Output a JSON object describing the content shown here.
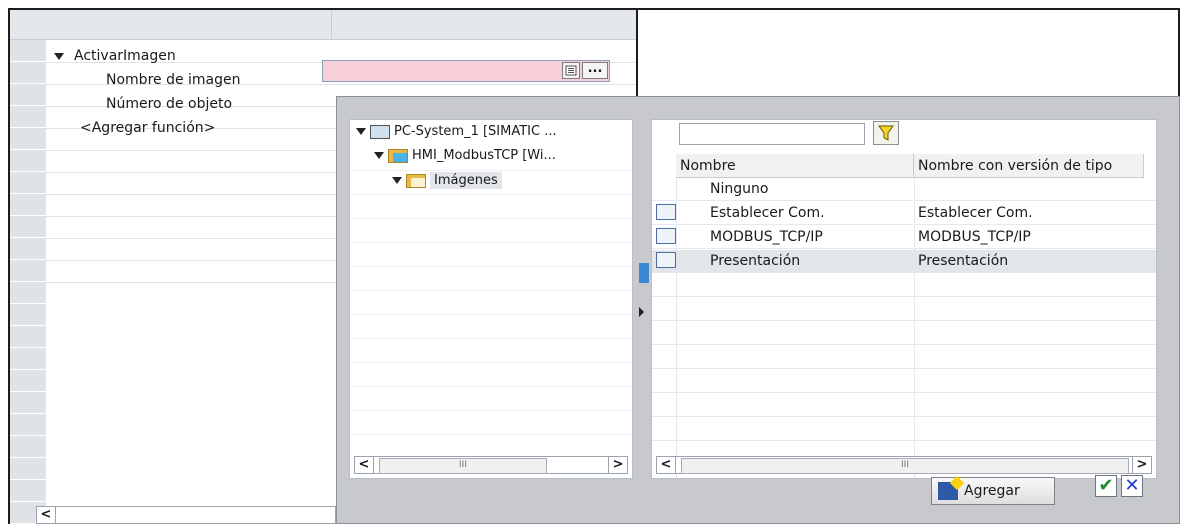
{
  "property_grid": {
    "rows": [
      {
        "label": "ActivarImagen",
        "expanded": true
      },
      {
        "label": "Nombre de imagen"
      },
      {
        "label": "Número de objeto"
      },
      {
        "label": "<Agregar función>"
      }
    ],
    "list_button_icon": "list-icon",
    "more_button_label": "..."
  },
  "popup": {
    "tree": [
      {
        "label": "PC-System_1 [SIMATIC ...",
        "icon": "pc-station-icon"
      },
      {
        "label": "HMI_ModbusTCP [Wi...",
        "icon": "hmi-folder-icon"
      },
      {
        "label": "Imágenes",
        "icon": "folder-icon",
        "selected": true
      }
    ],
    "filter_placeholder": "",
    "filter_icon": "funnel-icon",
    "columns": [
      "Nombre",
      "Nombre con versión de tipo"
    ],
    "items": [
      {
        "name": "Ninguno",
        "type_name": "",
        "has_icon": false
      },
      {
        "name": "Establecer Com.",
        "type_name": "Establecer Com.",
        "has_icon": true
      },
      {
        "name": "MODBUS_TCP/IP",
        "type_name": "MODBUS_TCP/IP",
        "has_icon": true
      },
      {
        "name": "Presentación",
        "type_name": "Presentación",
        "has_icon": true,
        "selected": true
      }
    ],
    "add_button_label": "Agregar",
    "ok_icon": "checkmark-icon",
    "cancel_icon": "x-icon",
    "scroll_left": "<",
    "scroll_right": ">",
    "scroll_thumb": "III"
  },
  "colors": {
    "value_cell_error": "#f6cfd8",
    "selection_bg": "#e2e6ea",
    "popup_bg": "#c7c9cc",
    "ok_green": "#1a8a2c",
    "cancel_blue": "#1d3fc6"
  }
}
